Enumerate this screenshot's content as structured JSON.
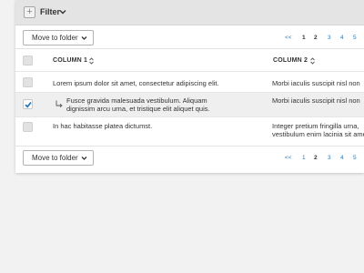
{
  "filter_bar": {
    "label": "Filter"
  },
  "toolbar": {
    "move_label": "Move to folder",
    "pagination": {
      "prev": "<<",
      "pages": [
        "1",
        "2",
        "3",
        "4",
        "5"
      ],
      "current": "2"
    }
  },
  "table": {
    "columns": [
      "COLUMN 1",
      "COLUMN 2"
    ],
    "rows": [
      {
        "checked": false,
        "child": false,
        "col1": [
          "Lorem ipsum dolor sit amet, consectetur adipiscing elit."
        ],
        "col2": [
          "Morbi iaculis suscipit nisl non"
        ]
      },
      {
        "checked": true,
        "child": true,
        "col1": [
          "Fusce gravida malesuada vestibulum. Aliquam",
          "dignissim arcu urna, et tristique elit aliquet quis."
        ],
        "col2": [
          "Morbi iaculis suscipit nisl non"
        ]
      },
      {
        "checked": false,
        "child": false,
        "col1": [
          "In hac habitasse platea dictumst."
        ],
        "col2": [
          "Integer pretium fringilla urna,",
          "vestibulum enim lacinia sit amet"
        ]
      }
    ]
  },
  "colors": {
    "link": "#2a78b6",
    "check": "#2a78b6",
    "selected_row": "#efefef",
    "filter_bar": "#e4e4e4"
  }
}
